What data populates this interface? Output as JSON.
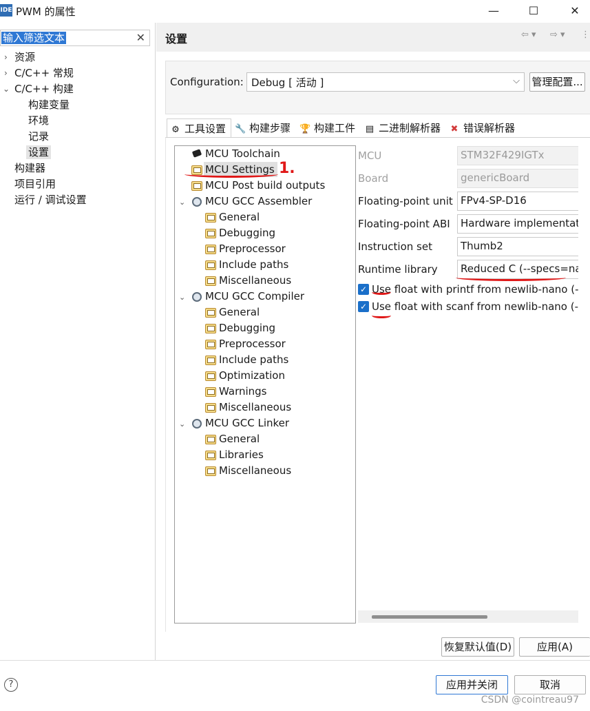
{
  "window": {
    "app_icon": "IDE",
    "title": "PWM 的属性",
    "minimize": "—",
    "maximize": "☐",
    "close": "✕"
  },
  "filter": {
    "value": "输入筛选文本",
    "clear": "✕"
  },
  "nav": {
    "items": [
      {
        "label": "资源"
      },
      {
        "label": "C/C++ 常规"
      },
      {
        "label": "C/C++ 构建"
      },
      {
        "label": "构建变量"
      },
      {
        "label": "环境"
      },
      {
        "label": "记录"
      },
      {
        "label": "设置"
      },
      {
        "label": "构建器"
      },
      {
        "label": "项目引用"
      },
      {
        "label": "运行 / 调试设置"
      }
    ],
    "selected": "设置"
  },
  "header": {
    "title": "设置",
    "back": "⇦ ▾",
    "forward": "⇨ ▾",
    "menu": "⋮"
  },
  "config": {
    "label": "Configuration:",
    "value": "Debug  [ 活动 ]",
    "dropdown": "⌵",
    "manage_button": "管理配置..."
  },
  "tabs": [
    {
      "label": "工具设置",
      "icon": "tool-settings-icon",
      "glyph": "⚙"
    },
    {
      "label": "构建步骤",
      "icon": "build-steps-icon",
      "glyph": "🔧"
    },
    {
      "label": "构建工件",
      "icon": "build-artifact-icon",
      "glyph": "🏆"
    },
    {
      "label": "二进制解析器",
      "icon": "binary-parser-icon",
      "glyph": "▤"
    },
    {
      "label": "错误解析器",
      "icon": "error-parser-icon",
      "glyph": "✖"
    }
  ],
  "tool_tree": {
    "toolchain": "MCU Toolchain",
    "settings": "MCU Settings",
    "post_build": "MCU Post build outputs",
    "assembler": {
      "label": "MCU GCC Assembler",
      "children": [
        "General",
        "Debugging",
        "Preprocessor",
        "Include paths",
        "Miscellaneous"
      ]
    },
    "compiler": {
      "label": "MCU GCC Compiler",
      "children": [
        "General",
        "Debugging",
        "Preprocessor",
        "Include paths",
        "Optimization",
        "Warnings",
        "Miscellaneous"
      ]
    },
    "linker": {
      "label": "MCU GCC Linker",
      "children": [
        "General",
        "Libraries",
        "Miscellaneous"
      ]
    }
  },
  "properties": {
    "mcu": {
      "label": "MCU",
      "value": "STM32F429IGTx"
    },
    "board": {
      "label": "Board",
      "value": "genericBoard"
    },
    "fpu": {
      "label": "Floating-point unit",
      "value": "FPv4-SP-D16"
    },
    "float_abi": {
      "label": "Floating-point ABI",
      "value": "Hardware implementati"
    },
    "instruction_set": {
      "label": "Instruction set",
      "value": "Thumb2"
    },
    "runtime_library": {
      "label": "Runtime library",
      "value": "Reduced C (--specs=nan"
    },
    "printf_float": {
      "label": "Use float with printf from newlib-nano (-u",
      "checked": true
    },
    "scanf_float": {
      "label": "Use float with scanf from newlib-nano (-u",
      "checked": true
    }
  },
  "buttons": {
    "restore_defaults": "恢复默认值(D)",
    "apply": "应用(A)",
    "apply_close": "应用并关闭",
    "cancel": "取消"
  },
  "help": "?",
  "watermark": "CSDN @cointreau97",
  "annotation_text": "1.",
  "colors": {
    "accent": "#1a6fc9",
    "annotation": "#e01818"
  }
}
